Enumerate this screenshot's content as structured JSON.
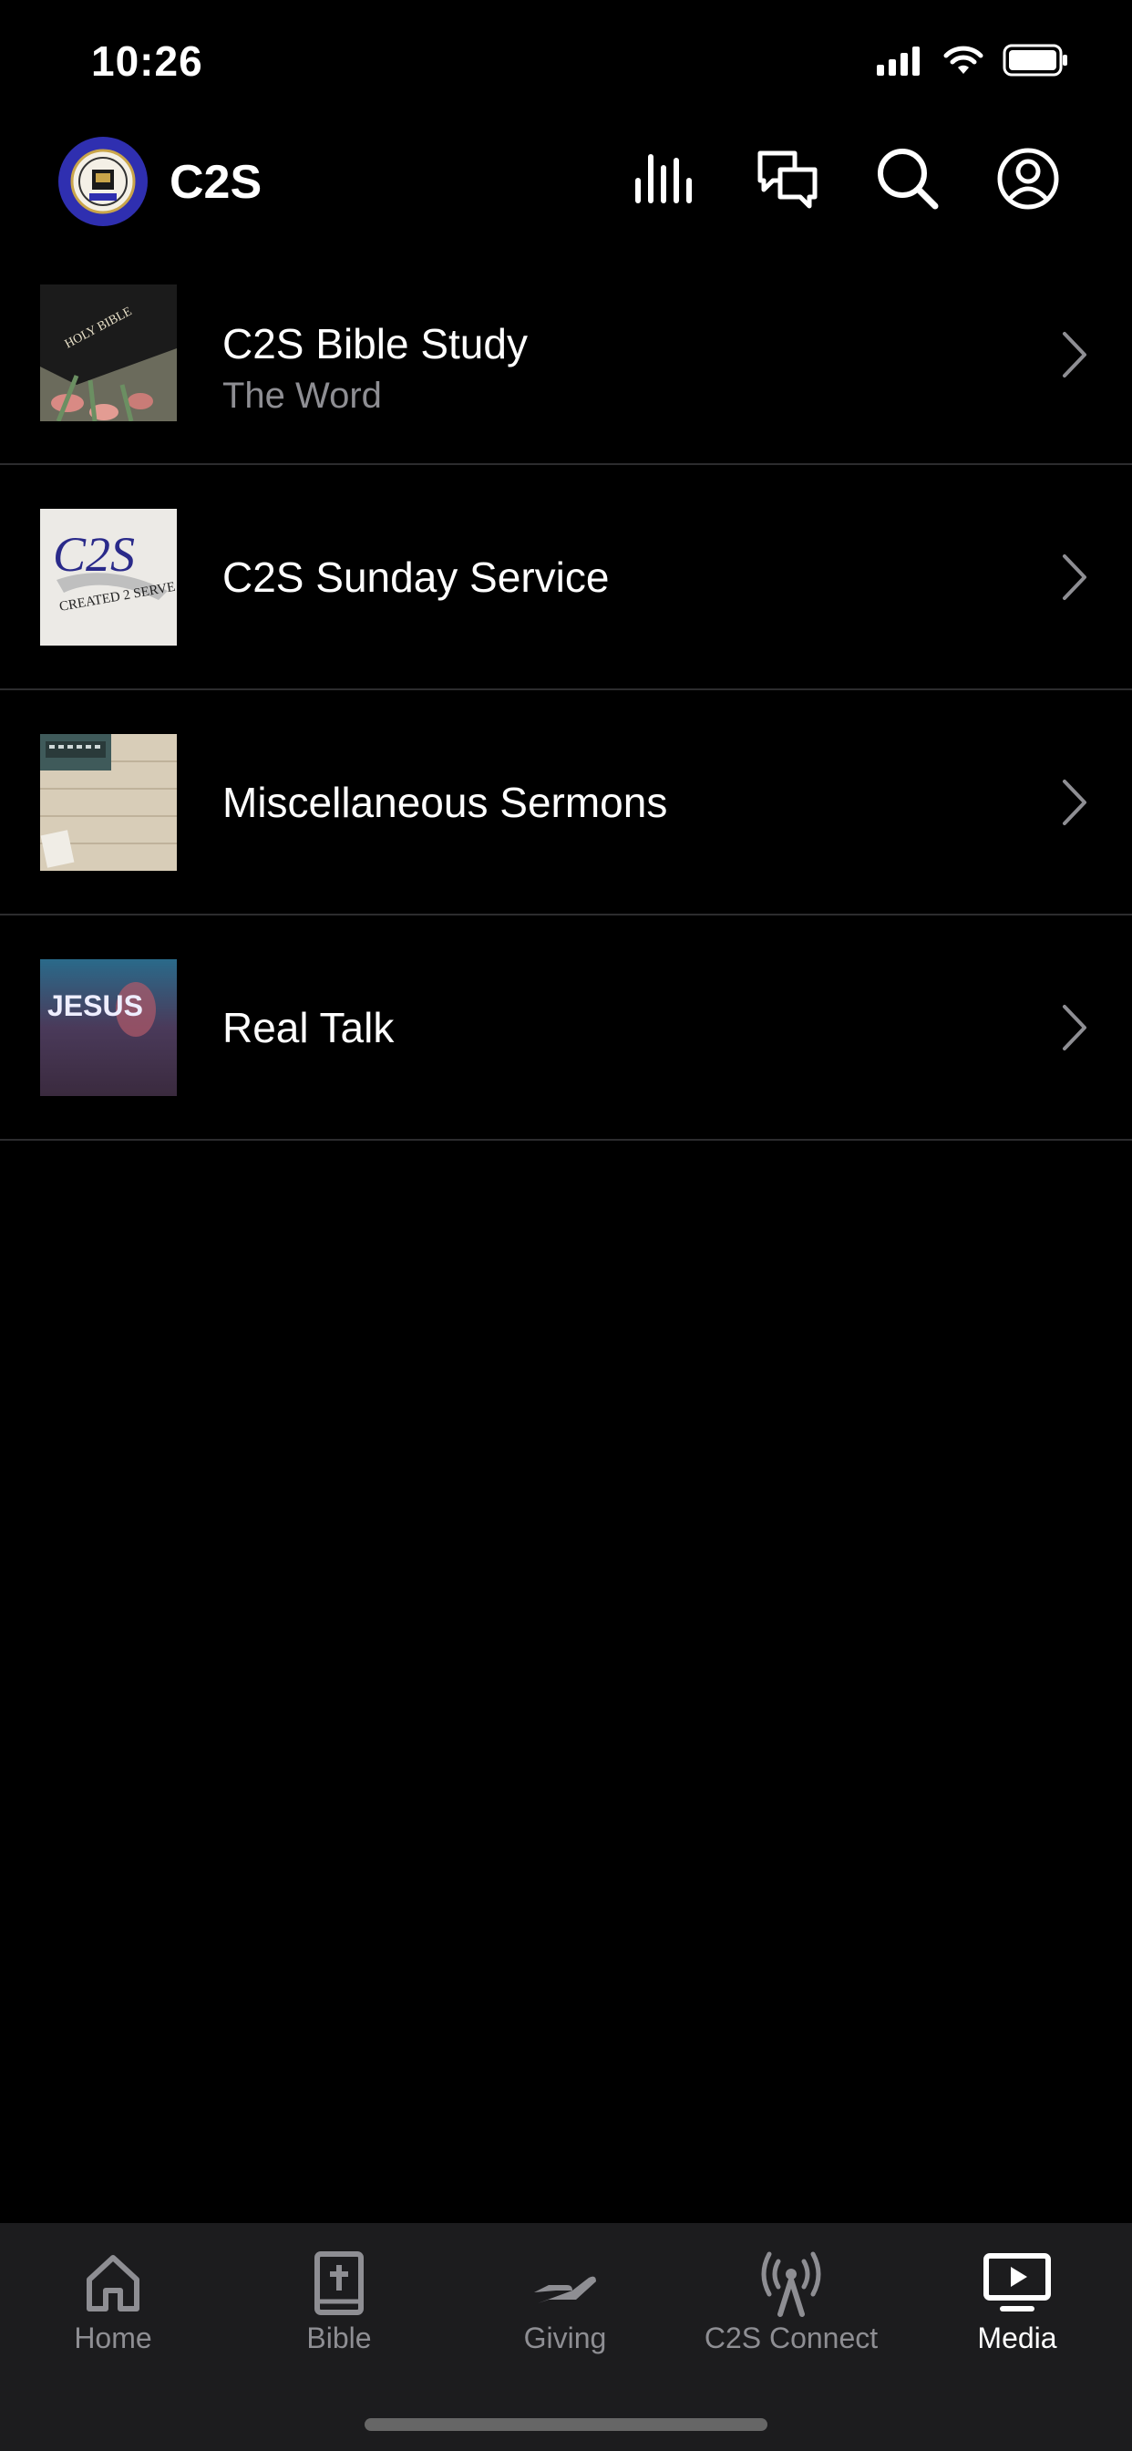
{
  "status_bar": {
    "time": "10:26"
  },
  "header": {
    "title": "C2S"
  },
  "icons": {
    "logo": "church-seal-logo",
    "header": [
      "audio-bars-icon",
      "chat-bubbles-icon",
      "search-icon",
      "account-icon"
    ],
    "chevron": "chevron-right-icon"
  },
  "media_items": [
    {
      "title": "C2S Bible Study",
      "subtitle": "The Word"
    },
    {
      "title": "C2S Sunday Service"
    },
    {
      "title": "Miscellaneous Sermons"
    },
    {
      "title": "Real Talk"
    }
  ],
  "thumbnails": {
    "bible_text": "HOLY BIBLE",
    "c2s_text": "C2S",
    "c2s_sub": "CREATED 2 SERVE",
    "jesus_text": "JESUS"
  },
  "tabs": [
    {
      "label": "Home",
      "icon": "home-icon"
    },
    {
      "label": "Bible",
      "icon": "bible-icon"
    },
    {
      "label": "Giving",
      "icon": "giving-hand-icon"
    },
    {
      "label": "C2S Connect",
      "icon": "broadcast-icon"
    },
    {
      "label": "Media",
      "icon": "media-play-icon",
      "active": true
    }
  ],
  "colors": {
    "background": "#000000",
    "tabbar": "#1c1c1e",
    "inactive": "#8e8e93",
    "logo": "#2f2fb0"
  }
}
